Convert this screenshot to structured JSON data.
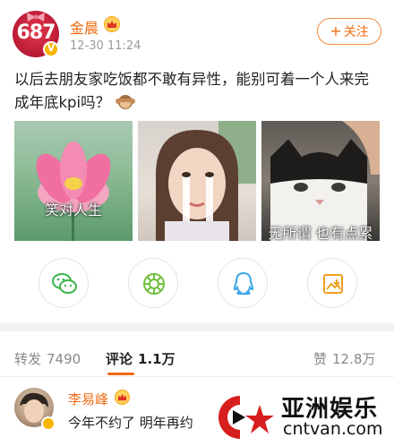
{
  "post": {
    "avatar_text": "687",
    "user_name": "金晨",
    "time": "12-30 11:24",
    "follow_label": "关注",
    "follow_plus": "+",
    "text": "以后去朋友家吃饭都不敢有异性，能别可着一个人来完成年底kpi吗？"
  },
  "images": [
    {
      "caption": "笑对人生",
      "icon": "lotus-flower"
    },
    {
      "caption": "",
      "icon": "woman-with-tape-tears"
    },
    {
      "caption": "无所谓 也有点累",
      "icon": "cat-being-petted"
    }
  ],
  "share": [
    {
      "icon": "wechat-icon"
    },
    {
      "icon": "moments-icon"
    },
    {
      "icon": "qq-icon"
    },
    {
      "icon": "save-image-icon"
    }
  ],
  "tabs": {
    "repost_label": "转发",
    "repost_count": "7490",
    "comment_label": "评论",
    "comment_count": "1.1万",
    "like_label": "赞",
    "like_count": "12.8万"
  },
  "comment": {
    "name": "李易峰",
    "text": "今年不约了 明年再约"
  },
  "watermark": {
    "cn": "亚洲娱乐",
    "en": "cntvan.com"
  },
  "colors": {
    "accent": "#f06b12",
    "username": "#f06b12",
    "verified": "#f7b500"
  }
}
